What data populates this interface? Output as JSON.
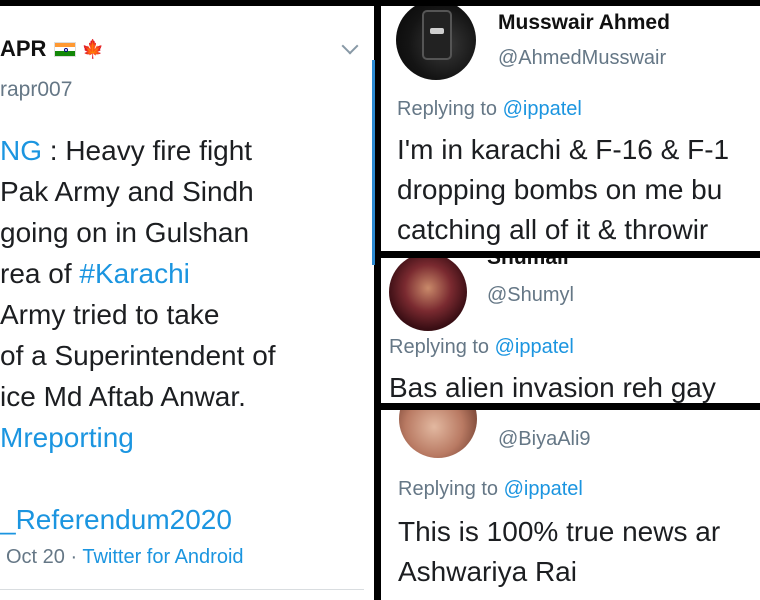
{
  "left_tweet": {
    "display_name": "APR",
    "handle": "rapr007",
    "lines": [
      {
        "link": "NG",
        "text": " : Heavy fire fight"
      },
      {
        "link": "",
        "text": "Pak Army and Sindh"
      },
      {
        "link": "",
        "text": "going on in Gulshan"
      },
      {
        "link": "#Karachi",
        "text": "rea of ",
        "link_after": true
      },
      {
        "link": "",
        "text": "Army tried to take"
      },
      {
        "link": "",
        "text": "of a Superintendent of"
      },
      {
        "link": "",
        "text": "ice Md Aftab Anwar."
      },
      {
        "link": "Mreporting",
        "text": ""
      },
      {
        "link": "",
        "text": ""
      },
      {
        "link": "_Referendum2020",
        "text": ""
      }
    ],
    "date": "Oct 20 · ",
    "client": "Twitter for Android"
  },
  "replies": [
    {
      "name": "Musswair Ahmed",
      "handle": "@AhmedMusswair",
      "replying_prefix": "Replying to ",
      "replying_to": "@ippatel",
      "lines": [
        "I'm in karachi & F-16 & F-1",
        "dropping bombs on me bu",
        "catching all of it & throwir"
      ]
    },
    {
      "name": "Shumail",
      "handle": "@Shumyl",
      "replying_prefix": "Replying to ",
      "replying_to": "@ippatel",
      "lines": [
        "Bas alien invasion reh gay"
      ]
    },
    {
      "name": "",
      "handle": "@BiyaAli9",
      "replying_prefix": "Replying to ",
      "replying_to": "@ippatel",
      "lines": [
        "This is 100% true news ar",
        "Ashwariya Rai"
      ]
    }
  ]
}
